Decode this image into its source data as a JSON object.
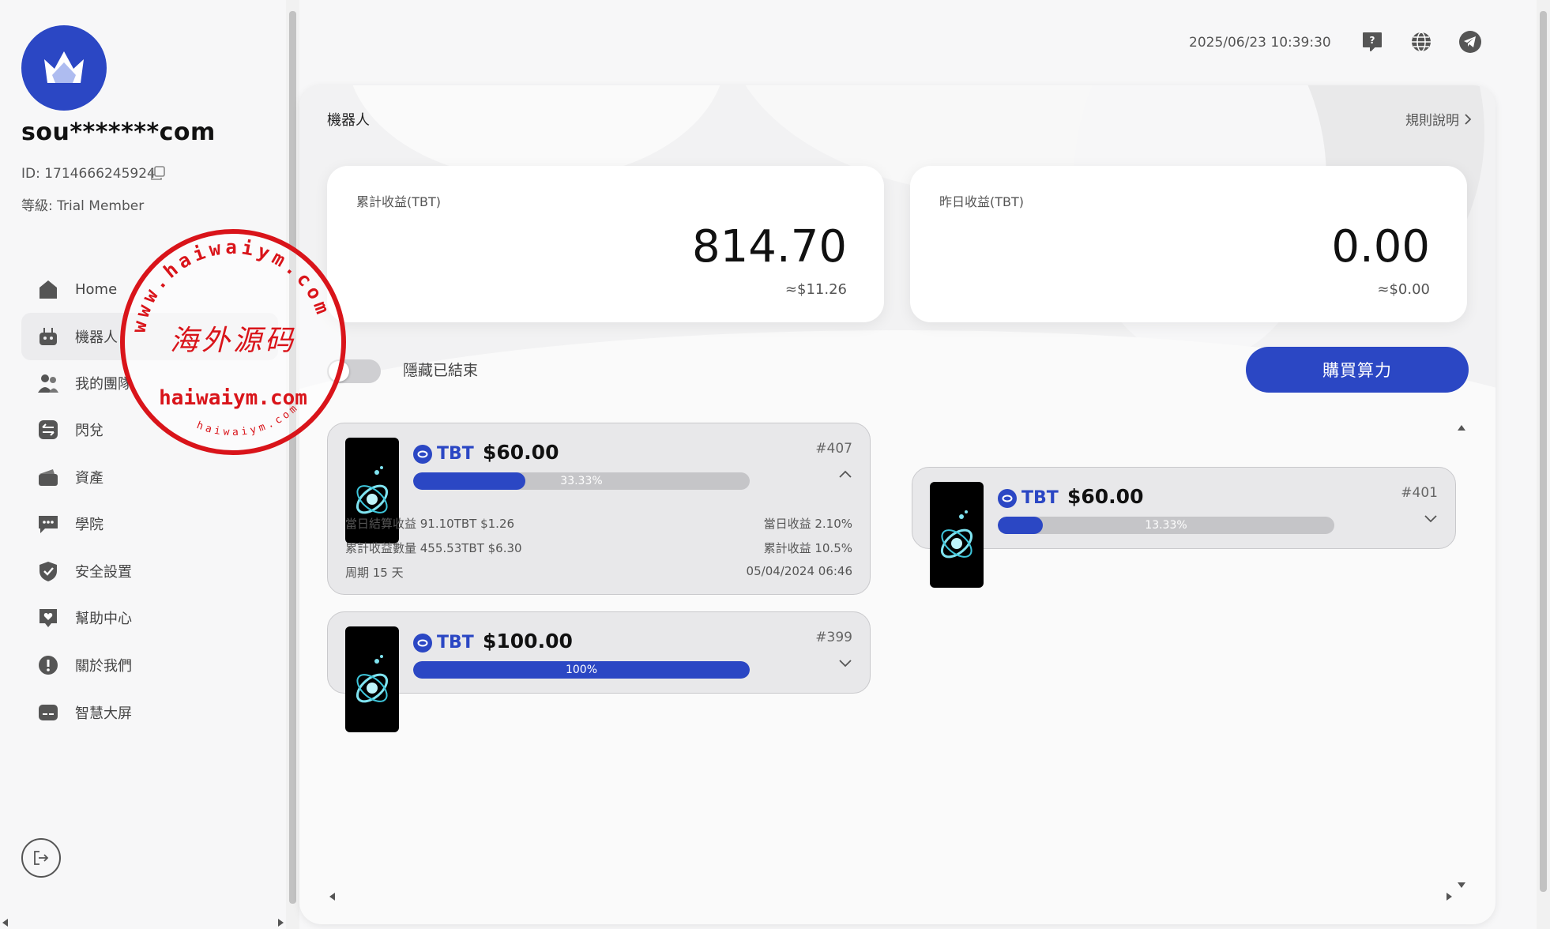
{
  "user": {
    "name": "sou*******com",
    "id_label": "ID: 1714666245924",
    "level_label": "等級: Trial Member"
  },
  "sidebar": {
    "items": [
      {
        "label": "Home",
        "icon": "home-icon"
      },
      {
        "label": "機器人",
        "icon": "robot-icon"
      },
      {
        "label": "我的團隊",
        "icon": "team-icon"
      },
      {
        "label": "閃兌",
        "icon": "swap-icon"
      },
      {
        "label": "資產",
        "icon": "wallet-icon"
      },
      {
        "label": "學院",
        "icon": "chat-icon"
      },
      {
        "label": "安全設置",
        "icon": "shield-icon"
      },
      {
        "label": "幫助中心",
        "icon": "help-heart-icon"
      },
      {
        "label": "關於我們",
        "icon": "info-icon"
      },
      {
        "label": "智慧大屏",
        "icon": "screen-icon"
      }
    ],
    "active_index": 1
  },
  "watermark": {
    "ring_text": "www.haiwaiym.com",
    "center_text": "海外源码",
    "domain_text": "haiwaiym.com",
    "bottom_text": "haiwaiym.com"
  },
  "header": {
    "datetime": "2025/06/23 10:39:30"
  },
  "panel": {
    "title": "機器人",
    "rules_label": "規則說明"
  },
  "stats": {
    "total": {
      "label": "累計收益(TBT)",
      "value": "814.70",
      "usd": "≈$11.26"
    },
    "yesterday": {
      "label": "昨日收益(TBT)",
      "value": "0.00",
      "usd": "≈$0.00"
    }
  },
  "controls": {
    "hide_finished_label": "隱藏已結束",
    "hide_finished_on": false,
    "buy_button_label": "購買算力"
  },
  "robots": [
    {
      "coin": "TBT",
      "amount": "$60.00",
      "number": "#407",
      "progress": 0.3333,
      "progress_label": "33.33%",
      "expanded": true,
      "daily_income_label": "當日結算收益 91.10TBT $1.26",
      "daily_rate_label": "當日收益 2.10%",
      "total_income_label": "累計收益數量 455.53TBT $6.30",
      "total_rate_label": "累計收益 10.5%",
      "period_label": "周期 15 天",
      "date_label": "05/04/2024 06:46"
    },
    {
      "coin": "TBT",
      "amount": "$100.00",
      "number": "#399",
      "progress": 1.0,
      "progress_label": "100%",
      "expanded": false
    },
    {
      "coin": "TBT",
      "amount": "$60.00",
      "number": "#401",
      "progress": 0.1333,
      "progress_label": "13.33%",
      "expanded": false
    }
  ],
  "colors": {
    "accent": "#2b47c4",
    "watermark": "#d9141a"
  }
}
